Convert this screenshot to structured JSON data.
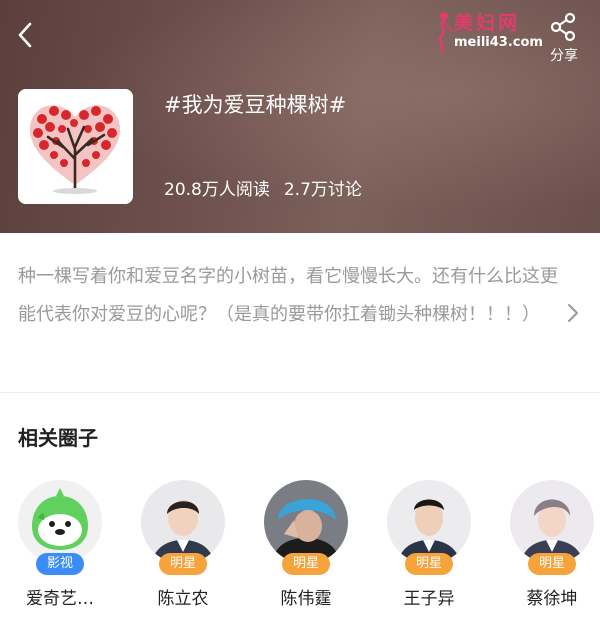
{
  "header": {
    "share_label": "分享",
    "watermark_text": "美妇网",
    "watermark_url": "meili43.com"
  },
  "topic": {
    "title": "#我为爱豆种棵树#",
    "reads": "20.8万人阅读",
    "discussions": "2.7万讨论",
    "description": "种一棵写着你和爱豆名字的小树苗，看它慢慢长大。还有什么比这更能代表你对爱豆的心呢？（是真的要带你扛着锄头种棵树！！！）"
  },
  "related": {
    "section_title": "相关圈子",
    "circles": [
      {
        "name": "爱奇艺…",
        "badge": "影视",
        "badge_color": "#3b8cf6"
      },
      {
        "name": "陈立农",
        "badge": "明星",
        "badge_color": "#f7a33b"
      },
      {
        "name": "陈伟霆",
        "badge": "明星",
        "badge_color": "#f7a33b"
      },
      {
        "name": "王子异",
        "badge": "明星",
        "badge_color": "#f7a33b"
      },
      {
        "name": "蔡徐坤",
        "badge": "明星",
        "badge_color": "#f7a33b"
      }
    ]
  }
}
